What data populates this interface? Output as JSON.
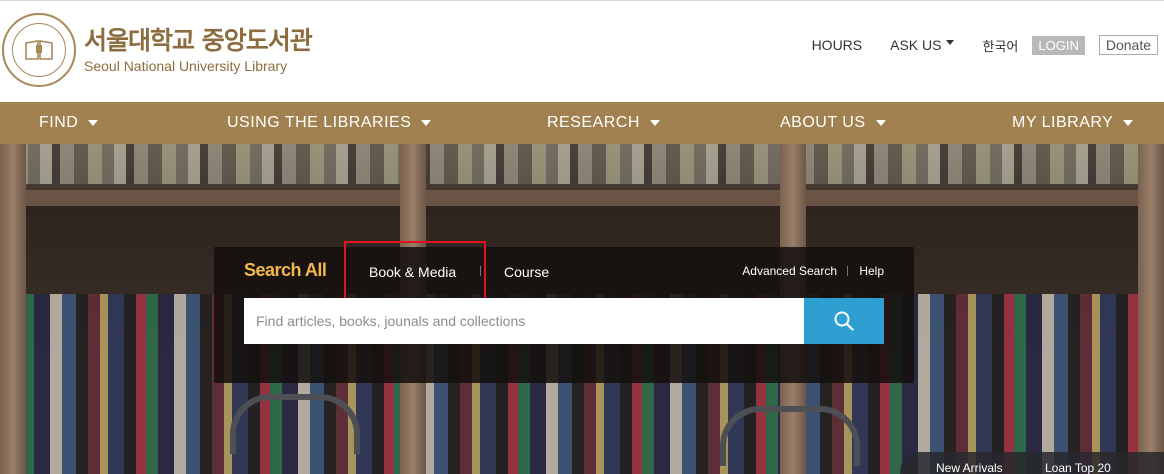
{
  "header": {
    "logo_ko": "서울대학교 중앙도서관",
    "logo_en": "Seoul National University Library",
    "seal_text": "SEOUL NATIONAL UNIVERSITY LIBRARY · 서울대학교중앙도서관",
    "util": {
      "hours": "HOURS",
      "ask_us": "ASK US",
      "korean": "한국어",
      "login": "LOGIN",
      "donate": "Donate"
    }
  },
  "nav": {
    "items": [
      {
        "label": "FIND"
      },
      {
        "label": "USING THE LIBRARIES"
      },
      {
        "label": "RESEARCH"
      },
      {
        "label": "ABOUT US"
      },
      {
        "label": "MY LIBRARY"
      }
    ]
  },
  "search": {
    "tabs": {
      "all": "Search All",
      "book_media": "Book & Media",
      "course": "Course"
    },
    "advanced": "Advanced Search",
    "help": "Help",
    "placeholder": "Find articles, books, jounals and collections",
    "value": ""
  },
  "quick_links": {
    "new_arrivals": "New Arrivals",
    "loan_top": "Loan Top 20"
  },
  "colors": {
    "brand_gold": "#a0814f",
    "search_all": "#f2b84b",
    "search_button": "#2d9fd1",
    "highlight_box": "#e0131f"
  }
}
